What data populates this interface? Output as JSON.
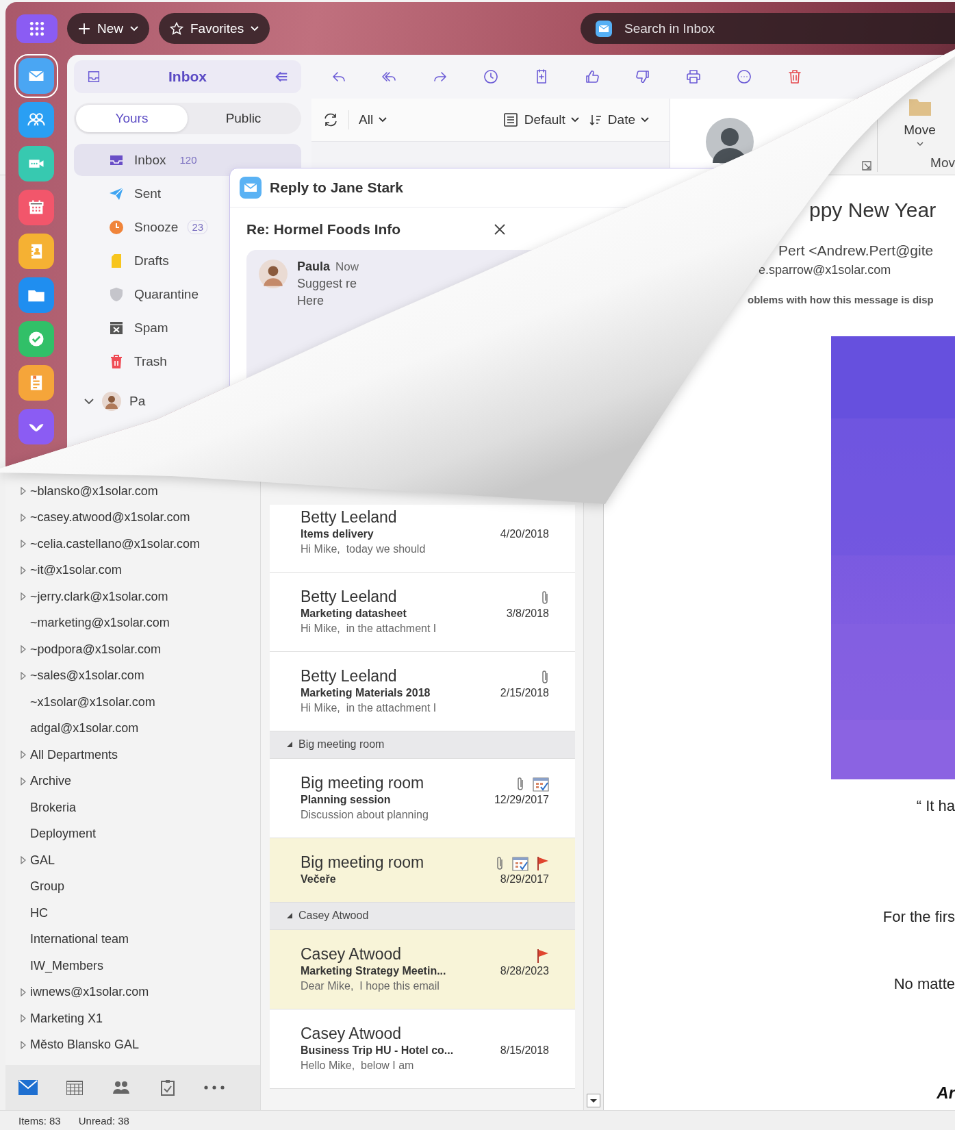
{
  "new_app": {
    "top_bar": {
      "new_button": "New",
      "favorites_button": "Favorites",
      "search": {
        "placeholder": "Search in Inbox"
      }
    },
    "app_rail": [
      {
        "selected": true
      },
      {
        "selected": false
      },
      {
        "selected": false
      },
      {
        "selected": false
      },
      {
        "selected": false
      },
      {
        "selected": false
      },
      {
        "selected": false
      },
      {
        "selected": false
      },
      {
        "selected": false
      }
    ],
    "folder_header": {
      "title": "Inbox"
    },
    "scope_tabs": [
      {
        "label": "Yours",
        "selected": true
      },
      {
        "label": "Public",
        "selected": false
      }
    ],
    "folders": [
      {
        "name": "Inbox",
        "count": "120",
        "selected": true
      },
      {
        "name": "Sent",
        "selected": false
      },
      {
        "name": "Snooze",
        "count": "23",
        "selected": false
      },
      {
        "name": "Drafts",
        "selected": false
      },
      {
        "name": "Quarantine",
        "selected": false
      },
      {
        "name": "Spam",
        "selected": false
      },
      {
        "name": "Trash",
        "selected": false
      }
    ],
    "account": {
      "name": "Pa",
      "expanded": true
    },
    "list_toolbar": {
      "filter": "All",
      "view": "Default",
      "sort": "Date"
    },
    "reply_window": {
      "title": "Reply to Jane Stark",
      "subject": "Re: Hormel Foods Info",
      "message": {
        "sender": "Paula",
        "time": "Now",
        "lines": [
          "Suggest re",
          "Here"
        ]
      }
    }
  },
  "old_app": {
    "ribbon": {
      "move_button": "Move",
      "group_label": "Mov"
    },
    "folders": [
      {
        "name": "~blansko@x1solar.com",
        "has_children": true
      },
      {
        "name": "~casey.atwood@x1solar.com",
        "has_children": true
      },
      {
        "name": "~celia.castellano@x1solar.com",
        "has_children": true
      },
      {
        "name": "~it@x1solar.com",
        "has_children": true
      },
      {
        "name": "~jerry.clark@x1solar.com",
        "has_children": true
      },
      {
        "name": "~marketing@x1solar.com",
        "has_children": false
      },
      {
        "name": "~podpora@x1solar.com",
        "has_children": true
      },
      {
        "name": "~sales@x1solar.com",
        "has_children": true
      },
      {
        "name": "~x1solar@x1solar.com",
        "has_children": false
      },
      {
        "name": "adgal@x1solar.com",
        "has_children": false
      },
      {
        "name": "All Departments",
        "has_children": true
      },
      {
        "name": "Archive",
        "has_children": true
      },
      {
        "name": "Brokeria",
        "has_children": false
      },
      {
        "name": "Deployment",
        "has_children": false
      },
      {
        "name": "GAL",
        "has_children": true
      },
      {
        "name": "Group",
        "has_children": false
      },
      {
        "name": "HC",
        "has_children": false
      },
      {
        "name": "International team",
        "has_children": false
      },
      {
        "name": "IW_Members",
        "has_children": false
      },
      {
        "name": "iwnews@x1solar.com",
        "has_children": true
      },
      {
        "name": "Marketing X1",
        "has_children": true
      },
      {
        "name": "Město Blansko GAL",
        "has_children": true
      }
    ],
    "messages": [
      {
        "kind": "message",
        "sender": "Betty Leeland",
        "subject": "Items delivery",
        "preview": "Hi Mike,  today we should",
        "date": "4/20/2018",
        "attachment": false,
        "meeting": false,
        "flagged": false,
        "highlighted": false
      },
      {
        "kind": "message",
        "sender": "Betty Leeland",
        "subject": "Marketing datasheet",
        "preview": "Hi Mike,  in the attachment I",
        "date": "3/8/2018",
        "attachment": true,
        "meeting": false,
        "flagged": false,
        "highlighted": false
      },
      {
        "kind": "message",
        "sender": "Betty Leeland",
        "subject": "Marketing Materials 2018",
        "preview": "Hi Mike,  in the attachment I",
        "date": "2/15/2018",
        "attachment": true,
        "meeting": false,
        "flagged": false,
        "highlighted": false
      },
      {
        "kind": "group",
        "label": "Big meeting room",
        "expanded": true
      },
      {
        "kind": "message",
        "sender": "Big meeting room",
        "subject": "Planning session",
        "preview": "Discussion about planning",
        "date": "12/29/2017",
        "attachment": true,
        "meeting": true,
        "flagged": false,
        "highlighted": false
      },
      {
        "kind": "message",
        "sender": "Big meeting room",
        "subject": "Večeře",
        "date": "8/29/2017",
        "attachment": true,
        "meeting": true,
        "flagged": true,
        "highlighted": true
      },
      {
        "kind": "group",
        "label": "Casey Atwood",
        "expanded": true
      },
      {
        "kind": "message",
        "sender": "Casey Atwood",
        "subject": "Marketing Strategy Meetin...",
        "preview": "Dear Mike,  I hope this email",
        "date": "8/28/2023",
        "attachment": false,
        "meeting": false,
        "flagged": true,
        "highlighted": true
      },
      {
        "kind": "message",
        "sender": "Casey Atwood",
        "subject": "Business Trip HU - Hotel co...",
        "preview": "Hello Mike,  below I am",
        "date": "8/15/2018",
        "attachment": false,
        "meeting": false,
        "flagged": false,
        "highlighted": false
      }
    ],
    "reading_pane": {
      "subject": "ppy New Year",
      "from": "Pert <Andrew.Pert@gite",
      "to": "e.sparrow@x1solar.com",
      "info": "oblems with how this message is disp",
      "body": [
        "“ It ha",
        "For the firs",
        "No matte"
      ],
      "signature": "Ar"
    },
    "nav": [
      {
        "selected": true
      },
      {
        "selected": false
      },
      {
        "selected": false
      },
      {
        "selected": false
      },
      {
        "selected": false
      }
    ],
    "status_bar": {
      "items": "Items: 83",
      "unread": "Unread: 38"
    }
  }
}
